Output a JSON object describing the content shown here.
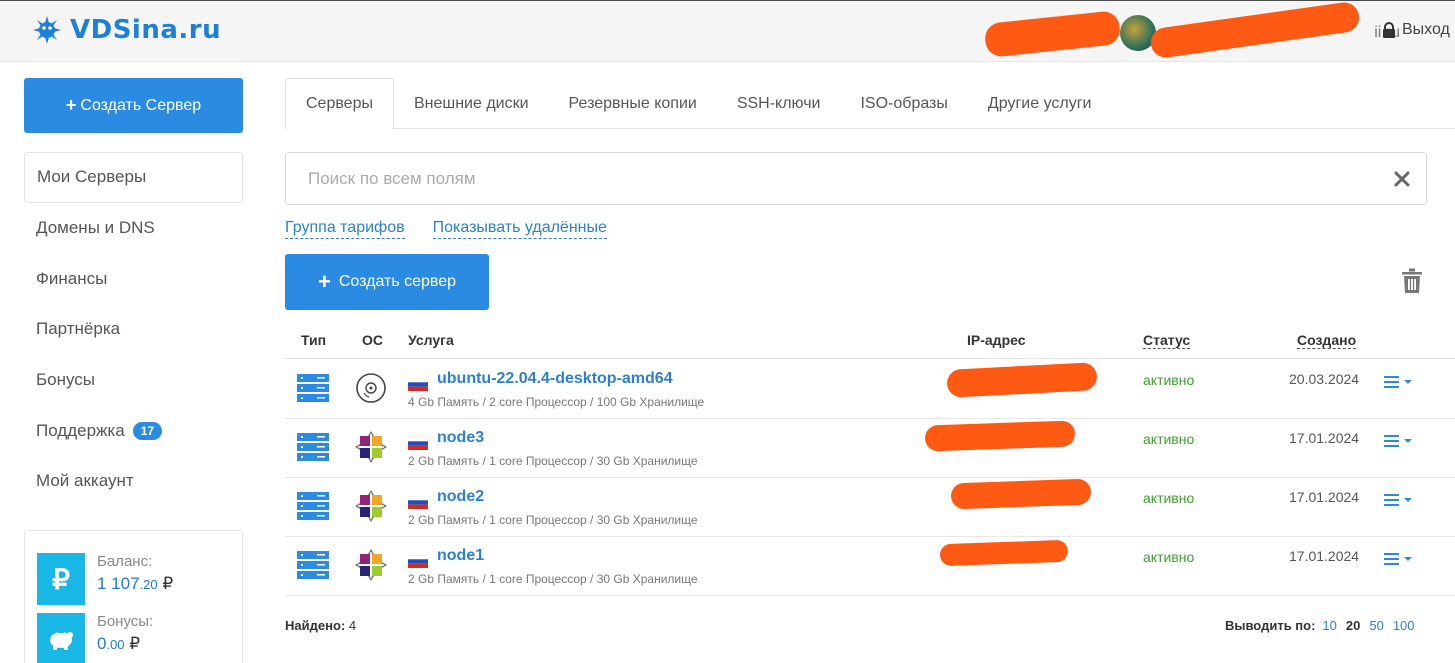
{
  "header": {
    "logo_text": "VDSina.ru",
    "user_email_visible": "ii.ru",
    "logout_label": "Выход"
  },
  "sidebar": {
    "create_label": "Создать Сервер",
    "items": [
      {
        "label": "Мои Серверы"
      },
      {
        "label": "Домены и DNS"
      },
      {
        "label": "Финансы"
      },
      {
        "label": "Партнёрка"
      },
      {
        "label": "Бонусы"
      },
      {
        "label": "Поддержка",
        "badge": "17"
      },
      {
        "label": "Мой аккаунт"
      }
    ],
    "balance": {
      "label": "Баланс:",
      "value_int": "1 107",
      "value_dec": ".20",
      "currency": "₽",
      "icon": "ruble-icon"
    },
    "bonuses": {
      "label": "Бонусы:",
      "value_int": "0",
      "value_dec": ".00",
      "currency": "₽",
      "icon": "piggy-bank-icon"
    }
  },
  "tabs": [
    {
      "label": "Серверы"
    },
    {
      "label": "Внешние диски"
    },
    {
      "label": "Резервные копии"
    },
    {
      "label": "SSH-ключи"
    },
    {
      "label": "ISO-образы"
    },
    {
      "label": "Другие услуги"
    }
  ],
  "search": {
    "placeholder": "Поиск по всем полям",
    "value": ""
  },
  "filters": {
    "tariff_group": "Группа тарифов",
    "show_deleted": "Показывать удалённые"
  },
  "create_server_label": "Создать сервер",
  "table": {
    "headers": {
      "type": "Тип",
      "os": "ОС",
      "service": "Услуга",
      "ip": "IP-адрес",
      "status": "Статус",
      "created": "Создано"
    },
    "rows": [
      {
        "name": "ubuntu-22.04.4-desktop-amd64",
        "spec": "4 Gb Память / 2 core Процессор / 100 Gb Хранилище",
        "status": "активно",
        "created": "20.03.2024",
        "os_icon": "disc-icon"
      },
      {
        "name": "node3",
        "spec": "2 Gb Память / 1 core Процессор / 30 Gb Хранилище",
        "status": "активно",
        "created": "17.01.2024",
        "os_icon": "centos-icon"
      },
      {
        "name": "node2",
        "spec": "2 Gb Память / 1 core Процессор / 30 Gb Хранилище",
        "status": "активно",
        "created": "17.01.2024",
        "os_icon": "centos-icon"
      },
      {
        "name": "node1",
        "spec": "2 Gb Память / 1 core Процессор / 30 Gb Хранилище",
        "status": "активно",
        "created": "17.01.2024",
        "os_icon": "centos-icon"
      }
    ]
  },
  "footer": {
    "found_label": "Найдено:",
    "found_count": "4",
    "per_page_label": "Выводить по:",
    "per_page_options": [
      "10",
      "20",
      "50",
      "100"
    ],
    "per_page_current": "20"
  },
  "colors": {
    "accent": "#2b8be3",
    "status_active": "#3fa02f",
    "redaction": "#ff5a13"
  }
}
